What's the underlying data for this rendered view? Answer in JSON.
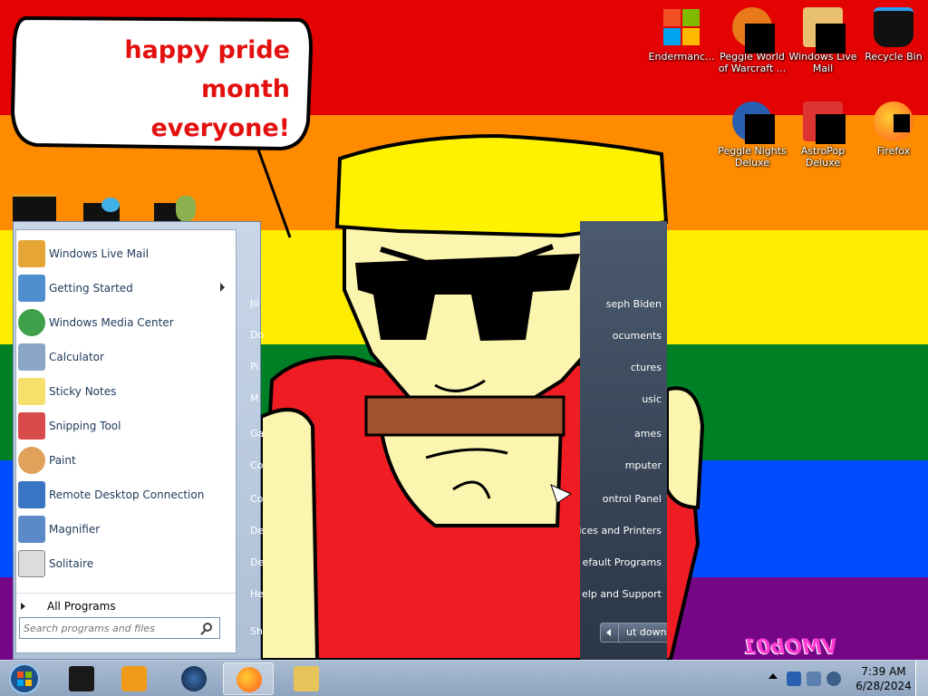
{
  "speech_bubble": {
    "line1": "happy pride month",
    "line2": "everyone!"
  },
  "desktop_icons": [
    {
      "label": "Recycle Bin",
      "icon": "recycle-bin-icon"
    },
    {
      "label": "Windows Live Mail",
      "icon": "mail-icon"
    },
    {
      "label": "Peggle World of Warcraft ...",
      "icon": "peggle-wow-icon"
    },
    {
      "label": "Endermanc...",
      "icon": "windows-logo-icon"
    },
    {
      "label": "Firefox",
      "icon": "firefox-icon"
    },
    {
      "label": "AstroPop Deluxe",
      "icon": "astropop-icon"
    },
    {
      "label": "Peggle Nights Deluxe",
      "icon": "peggle-nights-icon"
    }
  ],
  "start_menu": {
    "programs": [
      {
        "label": "Windows Live Mail",
        "icon": "mail-icon",
        "color": "#e6a635"
      },
      {
        "label": "Getting Started",
        "icon": "getting-started-icon",
        "color": "#4f8fd0",
        "has_submenu": true
      },
      {
        "label": "Windows Media Center",
        "icon": "media-center-icon",
        "color": "#3fa24a"
      },
      {
        "label": "Calculator",
        "icon": "calculator-icon",
        "color": "#8aa6c4"
      },
      {
        "label": "Sticky Notes",
        "icon": "sticky-notes-icon",
        "color": "#f4e06a"
      },
      {
        "label": "Snipping Tool",
        "icon": "scissors-icon",
        "color": "#d94a4a"
      },
      {
        "label": "Paint",
        "icon": "paint-icon",
        "color": "#e0a25a"
      },
      {
        "label": "Remote Desktop Connection",
        "icon": "remote-desktop-icon",
        "color": "#3a75c4"
      },
      {
        "label": "Magnifier",
        "icon": "magnifier-icon",
        "color": "#5c8ac9"
      },
      {
        "label": "Solitaire",
        "icon": "solitaire-icon",
        "color": "#dcdcdc"
      }
    ],
    "all_programs": "All Programs",
    "search_placeholder": "Search programs and files",
    "right_letters": [
      "Jo",
      "Do",
      "Pi",
      "M",
      "Ga",
      "Co",
      "Co",
      "De",
      "De",
      "He",
      "Sh"
    ]
  },
  "places_pane": {
    "items": [
      "seph Biden",
      "ocuments",
      "ctures",
      "usic",
      "ames",
      "mputer",
      "ontrol Panel",
      "evices and Printers",
      "efault Programs",
      "elp and Support"
    ],
    "shutdown": "ut down"
  },
  "taskbar": {
    "buttons": [
      {
        "name": "taskbar-app-black",
        "color": "#1a1a1a"
      },
      {
        "name": "taskbar-media-player",
        "color": "#f09a1a"
      },
      {
        "name": "taskbar-globe",
        "color": "#1f3b66"
      },
      {
        "name": "taskbar-firefox",
        "color": "#ff7a1a"
      },
      {
        "name": "taskbar-explorer",
        "color": "#e8c35a"
      }
    ],
    "clock_time": "7:39 AM",
    "clock_date": "6/28/2024"
  },
  "watermark": "VMOb01"
}
